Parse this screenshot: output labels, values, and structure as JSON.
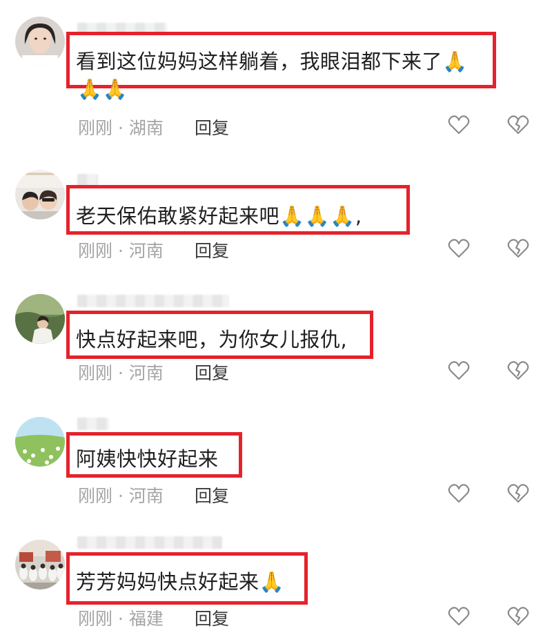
{
  "comments": [
    {
      "text_line1": "看到这位妈妈这样躺着，我眼泪都下来了🙏",
      "text_line2": "🙏🙏",
      "time": "刚刚",
      "separator": "·",
      "location": "湖南",
      "reply_label": "回复"
    },
    {
      "text_line1": "老天保佑敢紧好起来吧🙏🙏🙏,",
      "time": "刚刚",
      "separator": "·",
      "location": "河南",
      "reply_label": "回复"
    },
    {
      "text_line1": "快点好起来吧，为你女儿报仇,",
      "time": "刚刚",
      "separator": "·",
      "location": "河南",
      "reply_label": "回复"
    },
    {
      "text_line1": "阿姨快快好起来",
      "time": "刚刚",
      "separator": "·",
      "location": "河南",
      "reply_label": "回复"
    },
    {
      "text_line1": "芳芳妈妈快点好起来🙏",
      "time": "刚刚",
      "separator": "·",
      "location": "福建",
      "reply_label": "回复"
    }
  ],
  "icons": {
    "like": "heart-outline-icon",
    "dislike": "broken-heart-outline-icon"
  },
  "colors": {
    "highlight_border": "#e5222b",
    "meta_text": "#a4a4a4",
    "icon_stroke": "#8a8a8a"
  }
}
